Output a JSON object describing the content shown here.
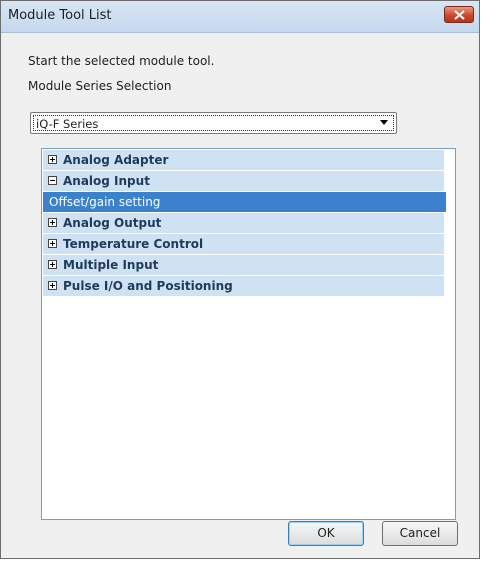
{
  "window": {
    "title": "Module Tool List"
  },
  "instruction": "Start the selected module tool.",
  "series_label": "Module Series Selection",
  "series_select": {
    "value": "iQ-F Series"
  },
  "tree": {
    "items": [
      {
        "label": "Analog Adapter",
        "expanded": false
      },
      {
        "label": "Analog Input",
        "expanded": true
      },
      {
        "label": "Offset/gain setting",
        "selected": true
      },
      {
        "label": "Analog Output",
        "expanded": false
      },
      {
        "label": "Temperature Control",
        "expanded": false
      },
      {
        "label": "Multiple Input",
        "expanded": false
      },
      {
        "label": "Pulse I/O and Positioning",
        "expanded": false
      }
    ]
  },
  "buttons": {
    "ok": "OK",
    "cancel": "Cancel"
  }
}
